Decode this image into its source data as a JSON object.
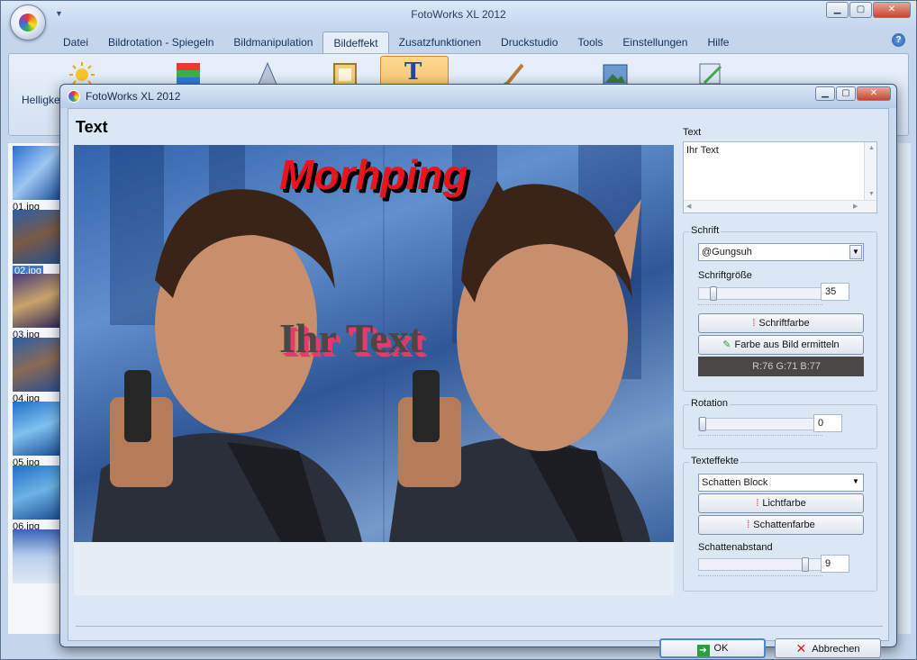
{
  "app": {
    "title": "FotoWorks XL 2012",
    "menu_tabs": [
      "Datei",
      "Bildrotation - Spiegeln",
      "Bildmanipulation",
      "Bildeffekt",
      "Zusatzfunktionen",
      "Druckstudio",
      "Tools",
      "Einstellungen",
      "Hilfe"
    ],
    "active_tab": "Bildeffekt",
    "ribbon_left_label": "Helligke",
    "thumbnails": [
      "01.jpg",
      "02.jpg",
      "03.jpg",
      "04.jpg",
      "05.jpg",
      "06.jpg"
    ],
    "selected_thumbnail": "02.jpg"
  },
  "dialog": {
    "title": "FotoWorks XL 2012",
    "section_title": "Text",
    "preview": {
      "top_text": "Morhping",
      "overlay_text": "Ihr Text"
    },
    "text_label": "Text",
    "text_value": "Ihr Text",
    "font_group": {
      "title": "Schrift",
      "font_value": "@Gungsuh",
      "size_label": "Schriftgröße",
      "size_value": "35",
      "font_color_button": "Schriftfarbe",
      "pick_color_button": "Farbe aus Bild ermitteln",
      "rgb_readout": "R:76  G:71  B:77"
    },
    "rotation_group": {
      "title": "Rotation",
      "value": "0"
    },
    "effects_group": {
      "title": "Texteffekte",
      "effect_value": "Schatten Block",
      "light_color_button": "Lichtfarbe",
      "shadow_color_button": "Schattenfarbe",
      "shadow_distance_label": "Schattenabstand",
      "shadow_distance_value": "9"
    },
    "ok_button": "OK",
    "cancel_button": "Abbrechen"
  },
  "colors": {
    "accent": "#3d78c9",
    "text_red": "#e8141e",
    "overlay_gray": "#4c4747",
    "overlay_shadow": "#e63a6a"
  }
}
